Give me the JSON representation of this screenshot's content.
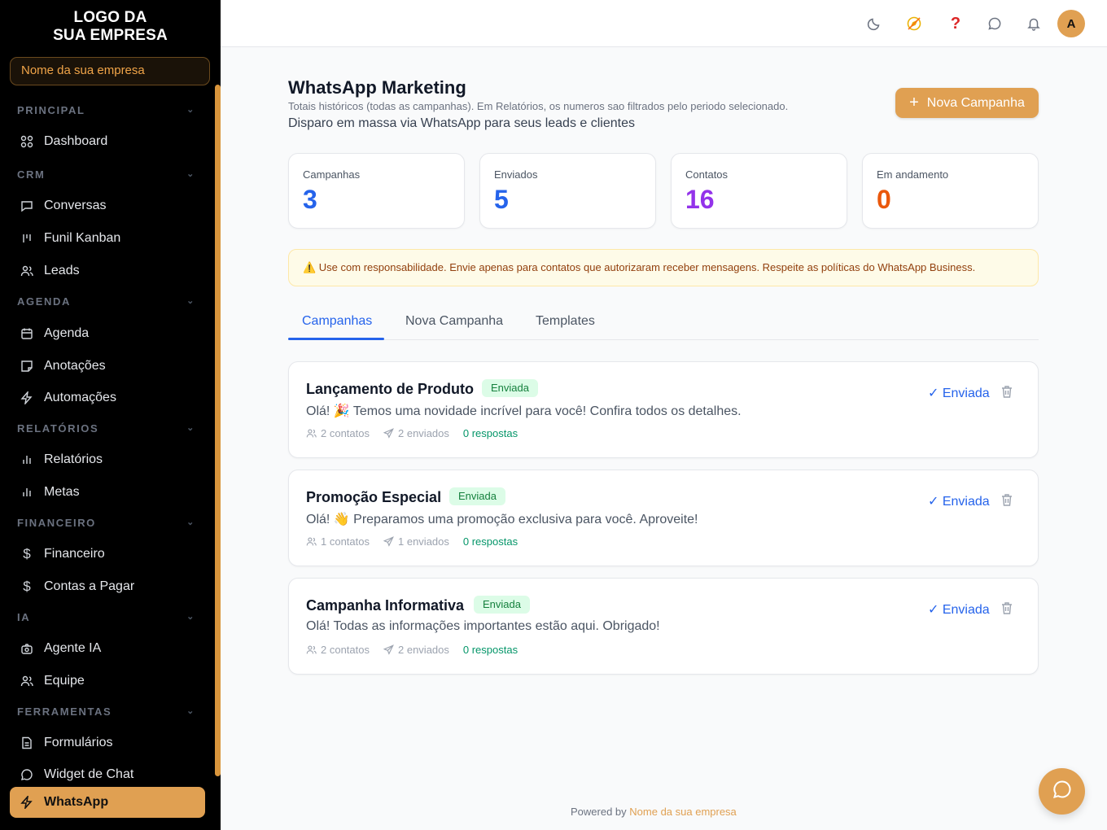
{
  "sidebar": {
    "logo_line1": "LOGO DA",
    "logo_line2": "SUA EMPRESA",
    "company": "Nome da sua empresa",
    "sections": {
      "principal": "PRINCIPAL",
      "crm": "CRM",
      "agenda": "AGENDA",
      "relatorios": "RELATÓRIOS",
      "financeiro": "FINANCEIRO",
      "ia": "IA",
      "ferramentas": "FERRAMENTAS"
    },
    "items": {
      "dashboard": "Dashboard",
      "conversas": "Conversas",
      "funil": "Funil Kanban",
      "leads": "Leads",
      "agenda": "Agenda",
      "anotacoes": "Anotações",
      "automacoes": "Automações",
      "relatorios": "Relatórios",
      "metas": "Metas",
      "financeiro": "Financeiro",
      "contas": "Contas a Pagar",
      "agente": "Agente IA",
      "equipe": "Equipe",
      "formularios": "Formulários",
      "widget": "Widget de Chat",
      "whatsapp": "WhatsApp"
    }
  },
  "header": {
    "avatar_initial": "A",
    "icons": [
      "moon-icon",
      "compass-icon",
      "help-icon",
      "chat-icon",
      "bell-icon"
    ]
  },
  "page": {
    "title": "WhatsApp Marketing",
    "note": "Totais históricos (todas as campanhas). Em Relatórios, os numeros sao filtrados pelo periodo selecionado.",
    "subtitle": "Disparo em massa via WhatsApp para seus leads e clientes",
    "new_button": "Nova Campanha"
  },
  "stats": [
    {
      "label": "Campanhas",
      "value": "3",
      "color": "#2563eb"
    },
    {
      "label": "Enviados",
      "value": "5",
      "color": "#2563eb"
    },
    {
      "label": "Contatos",
      "value": "16",
      "color": "#9333ea"
    },
    {
      "label": "Em andamento",
      "value": "0",
      "color": "#ea580c"
    }
  ],
  "warning": "⚠️ Use com responsabilidade. Envie apenas para contatos que autorizaram receber mensagens. Respeite as políticas do WhatsApp Business.",
  "tabs": [
    "Campanhas",
    "Nova Campanha",
    "Templates"
  ],
  "campaigns": [
    {
      "title": "Lançamento de Produto",
      "badge": "Enviada",
      "message": "Olá! 🎉 Temos uma novidade incrível para você! Confira todos os detalhes.",
      "contacts": "2 contatos",
      "sent": "2 enviados",
      "responses": "0 respostas",
      "status": "✓ Enviada"
    },
    {
      "title": "Promoção Especial",
      "badge": "Enviada",
      "message": "Olá! 👋 Preparamos uma promoção exclusiva para você. Aproveite!",
      "contacts": "1 contatos",
      "sent": "1 enviados",
      "responses": "0 respostas",
      "status": "✓ Enviada"
    },
    {
      "title": "Campanha Informativa",
      "badge": "Enviada",
      "message": "Olá! Todas as informações importantes estão aqui. Obrigado!",
      "contacts": "2 contatos",
      "sent": "2 enviados",
      "responses": "0 respostas",
      "status": "✓ Enviada"
    }
  ],
  "footer": {
    "prefix": "Powered by",
    "brand": "Nome da sua empresa"
  },
  "colors": {
    "accent": "#e0a052",
    "primary": "#2563eb"
  }
}
